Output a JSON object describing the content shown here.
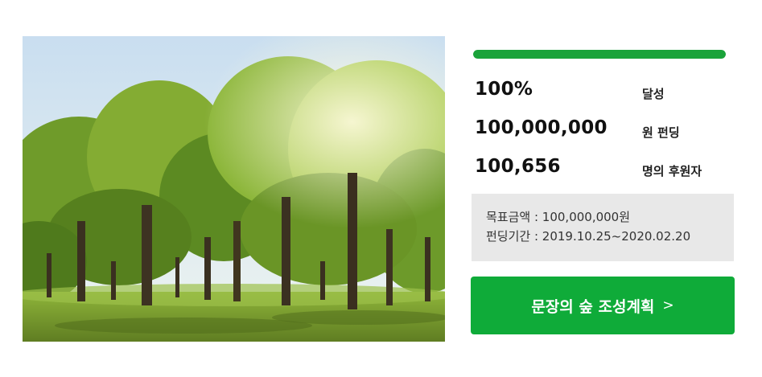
{
  "funding": {
    "progress_percent": 100,
    "stats": [
      {
        "value": "100%",
        "unit": "달성"
      },
      {
        "value": "100,000,000",
        "unit": "원 펀딩"
      },
      {
        "value": "100,656",
        "unit": "명의 후원자"
      }
    ],
    "goal_label": "목표금액 : 100,000,000원",
    "period_label": "펀딩기간 : 2019.10.25~2020.02.20",
    "cta_label": "문장의 숲 조성계획",
    "cta_arrow": ">"
  },
  "colors": {
    "accent": "#0fab39",
    "progress": "#1aa33a",
    "info_bg": "#e8e8e8"
  },
  "icons": {
    "cta_arrow_icon": "chevron-right-icon"
  }
}
